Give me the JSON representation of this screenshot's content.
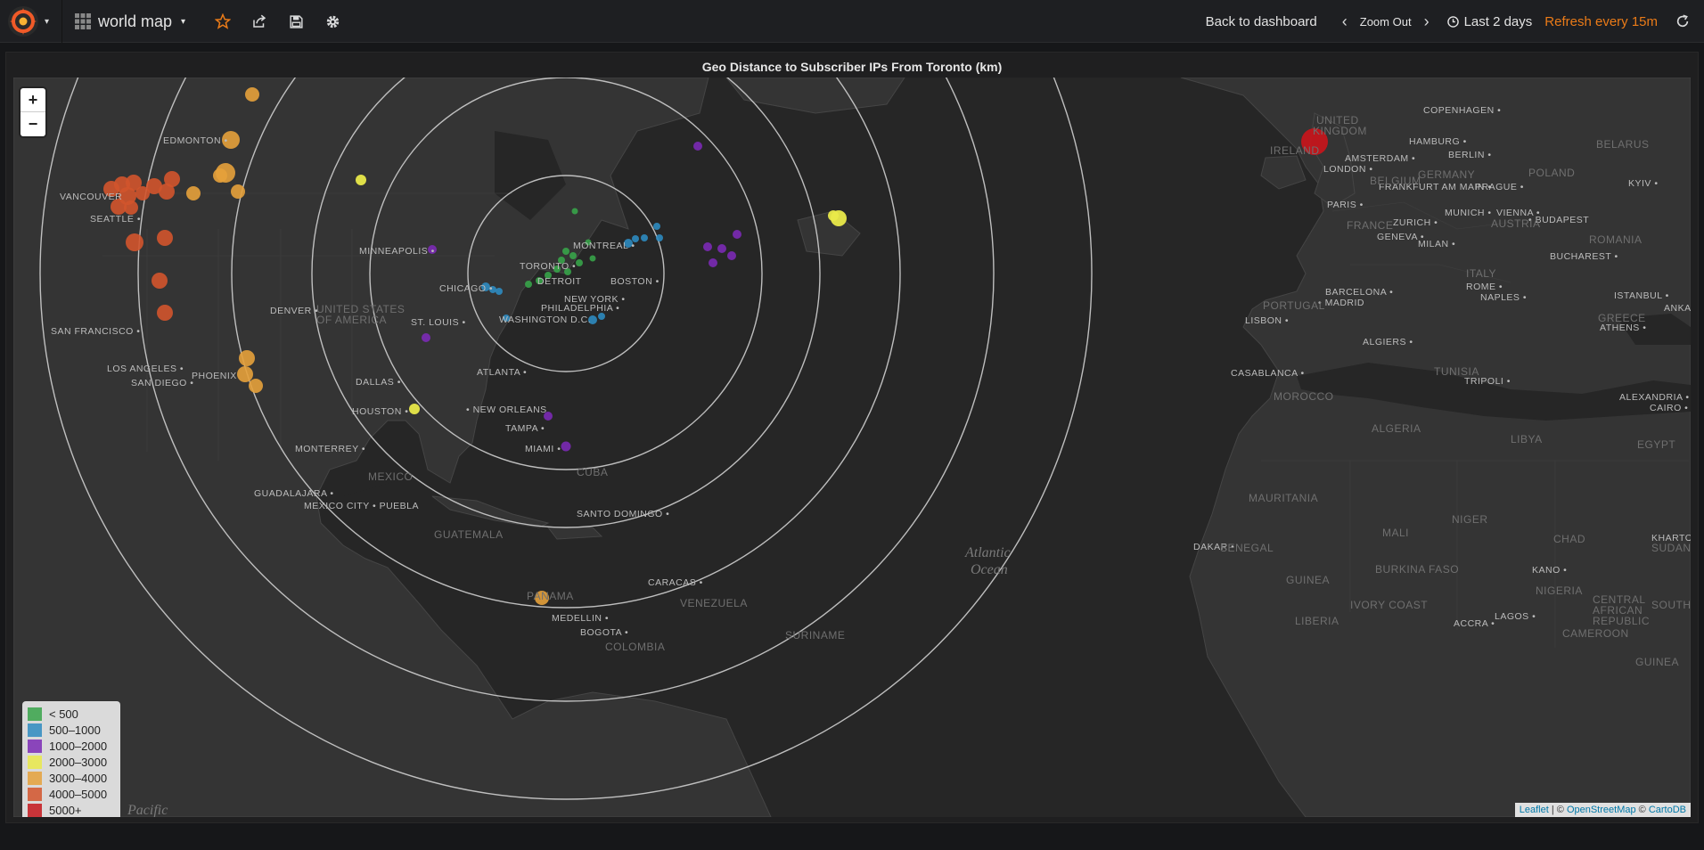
{
  "navbar": {
    "dashboard_title": "world map",
    "back_label": "Back to dashboard",
    "zoom_out_label": "Zoom Out",
    "time_range_label": "Last 2 days",
    "refresh_label": "Refresh every 15m"
  },
  "panel": {
    "title": "Geo Distance to Subscriber IPs From Toronto (km)"
  },
  "map": {
    "zoom_in": "+",
    "zoom_out": "−",
    "ocean_label_1": "Atlantic",
    "ocean_label_2": "Ocean",
    "ocean_label_pacific": "Pacific",
    "cities": [
      "EDMONTON",
      "VANCOUVER",
      "SEATTLE",
      "MINNEAPOLIS",
      "TORONTO",
      "DETROIT",
      "MONTREAL",
      "BOSTON",
      "CHICAGO",
      "NEW YORK",
      "PHILADELPHIA",
      "WASHINGTON D.C.",
      "DENVER",
      "ST. LOUIS",
      "SAN FRANCISCO",
      "LOS ANGELES",
      "PHOENIX",
      "SAN DIEGO",
      "DALLAS",
      "ATLANTA",
      "HOUSTON",
      "NEW ORLEANS",
      "TAMPA",
      "MIAMI",
      "MONTERREY",
      "GUADALAJARA",
      "MEXICO CITY",
      "PUEBLA",
      "SANTO DOMINGO",
      "CARACAS",
      "MEDELLIN",
      "BOGOTA",
      "COPENHAGEN",
      "HAMBURG",
      "AMSTERDAM",
      "BERLIN",
      "LONDON",
      "FRANKFURT AM MAIN",
      "PRAGUE",
      "PARIS",
      "MUNICH",
      "VIENNA",
      "ZURICH",
      "GENEVA",
      "MILAN",
      "BUDAPEST",
      "BUCHAREST",
      "KYIV",
      "BARCELONA",
      "MADRID",
      "ROME",
      "NAPLES",
      "ISTANBUL",
      "ANKARA",
      "LISBON",
      "ATHENS",
      "ALGIERS",
      "CASABLANCA",
      "TRIPOLI",
      "ALEXANDRIA",
      "CAIRO",
      "DAKAR",
      "KANO",
      "LAGOS",
      "ACCRA",
      "KHARTOUM"
    ],
    "regions": [
      "UNITED KINGDOM",
      "IRELAND",
      "BELARUS",
      "POLAND",
      "GERMANY",
      "BELGIUM",
      "FRANCE",
      "AUSTRIA",
      "ROMANIA",
      "ITALY",
      "GREECE",
      "PORTUGAL",
      "TUNISIA",
      "MOROCCO",
      "ALGERIA",
      "LIBYA",
      "EGYPT",
      "MAURITANIA",
      "MALI",
      "NIGER",
      "CHAD",
      "SENEGAL",
      "BURKINA FASO",
      "GUINEA",
      "IVORY COAST",
      "LIBERIA",
      "NIGERIA",
      "CAMEROON",
      "CENTRAL AFRICAN REPUBLIC",
      "SOUTH SUDAN",
      "SUDAN",
      "GUINEA",
      "UNITED STATES OF AMERICA",
      "MEXICO",
      "CUBA",
      "GUATEMALA",
      "PANAMA",
      "VENEZUELA",
      "COLOMBIA",
      "SURINAME"
    ]
  },
  "legend": [
    {
      "label": "< 500",
      "color": "#37a349"
    },
    {
      "label": "500–1000",
      "color": "#2e8bc0"
    },
    {
      "label": "1000–2000",
      "color": "#7b2ab5"
    },
    {
      "label": "2000–3000",
      "color": "#e9e94a"
    },
    {
      "label": "3000–4000",
      "color": "#e5a13b"
    },
    {
      "label": "4000–5000",
      "color": "#d2542c"
    },
    {
      "label": "5000+",
      "color": "#c4161c"
    }
  ],
  "attribution": {
    "leaflet": "Leaflet",
    "sep": " | © ",
    "osm": "OpenStreetMap",
    "sep2": " © ",
    "carto": "CartoDB"
  }
}
